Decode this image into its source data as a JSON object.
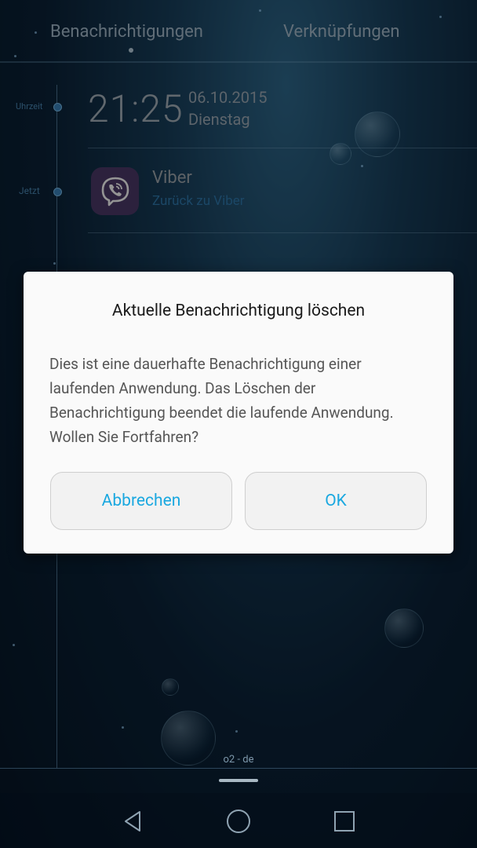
{
  "tabs": {
    "notifications": "Benachrichtigungen",
    "shortcuts": "Verknüpfungen"
  },
  "timeline": {
    "label_time": "Uhrzeit",
    "label_now": "Jetzt"
  },
  "clock": {
    "time": "21:25",
    "date": "06.10.2015",
    "weekday": "Dienstag"
  },
  "notification": {
    "app_name": "Viber",
    "action": "Zurück zu Viber",
    "icon": "viber-icon"
  },
  "dialog": {
    "title": "Aktuelle Benachrichtigung löschen",
    "body": "Dies ist eine dauerhafte Benachrichtigung einer laufenden Anwendung. Das Löschen der Benachrichtigung beendet die laufende Anwendung. Wollen Sie Fortfahren?",
    "cancel_label": "Abbrechen",
    "ok_label": "OK"
  },
  "footer": {
    "carrier": "o2 - de"
  },
  "colors": {
    "accent": "#1aa8e0",
    "viber": "#4d3a69"
  }
}
